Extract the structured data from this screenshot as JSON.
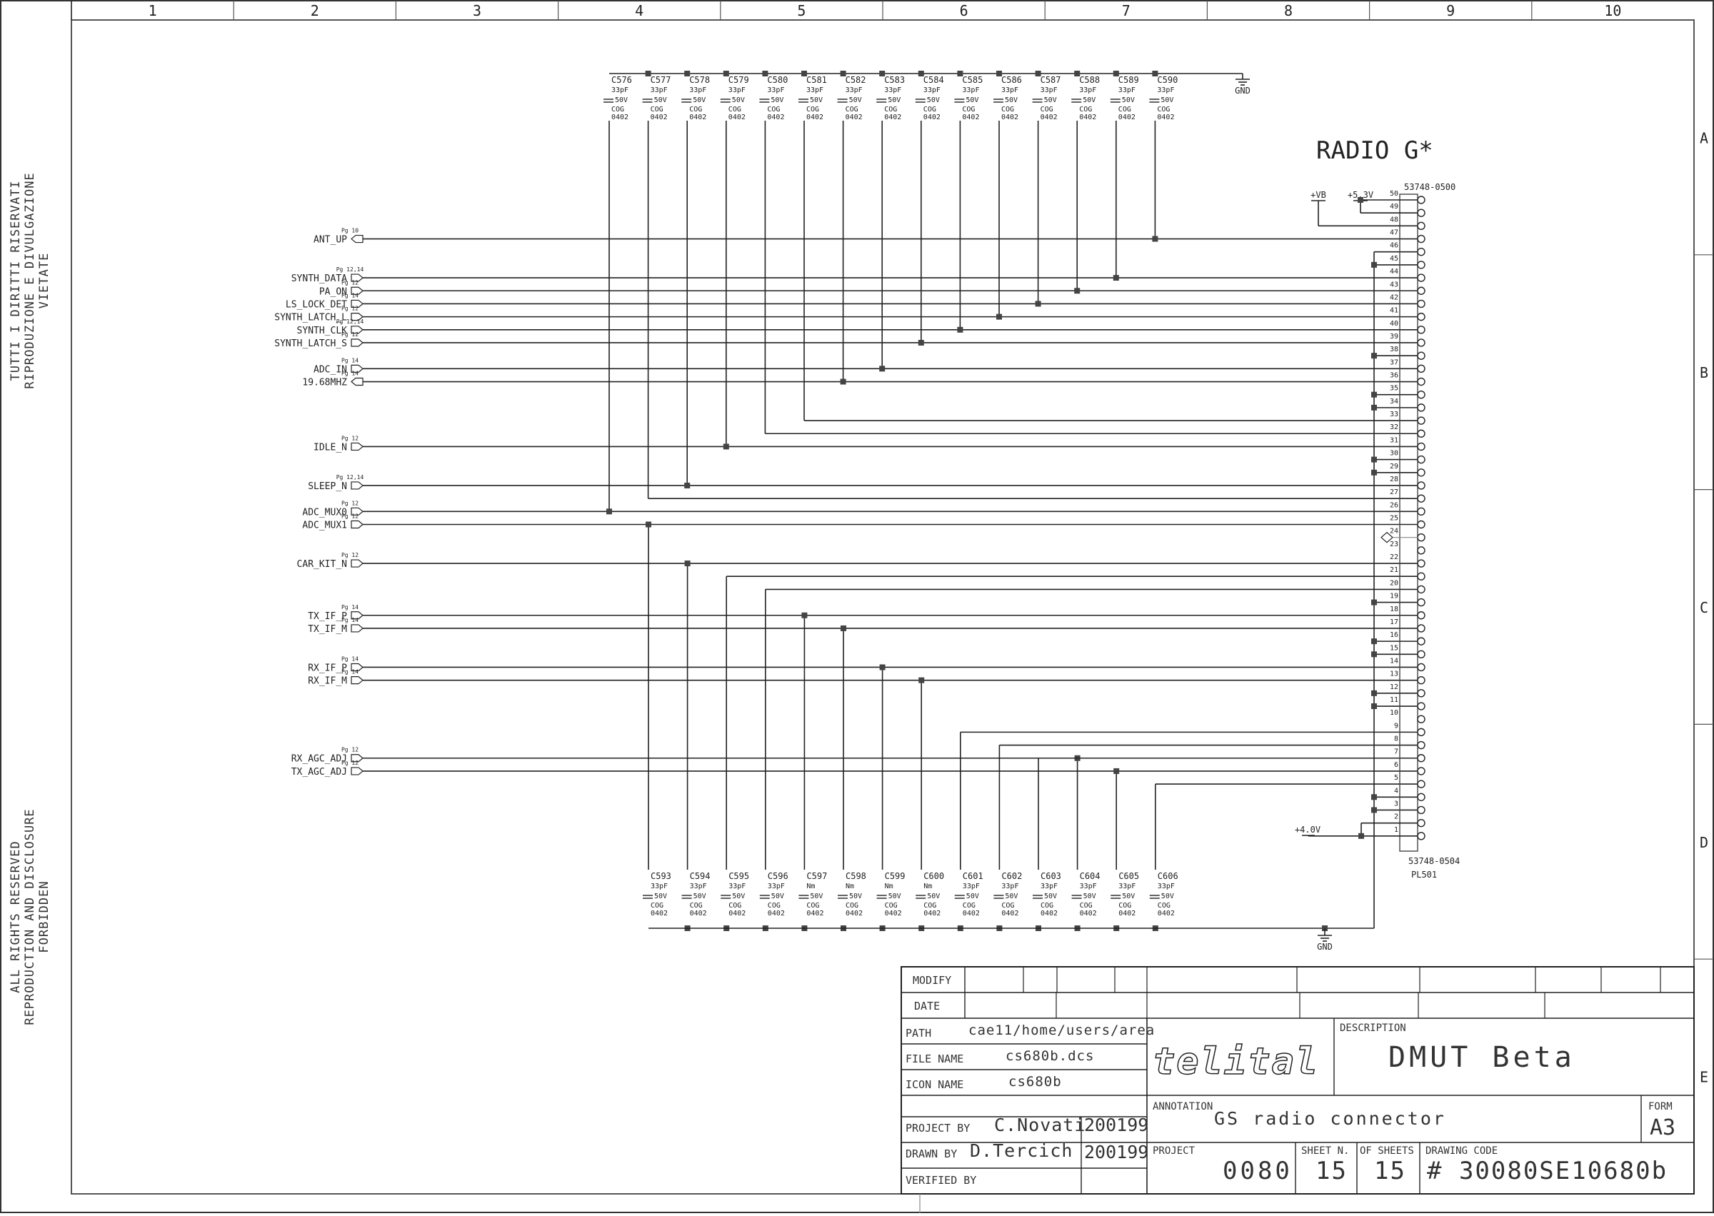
{
  "border": {
    "columns": [
      "1",
      "2",
      "3",
      "4",
      "5",
      "6",
      "7",
      "8",
      "9",
      "10"
    ],
    "rows": [
      "A",
      "B",
      "C",
      "D",
      "E"
    ]
  },
  "side_notes": {
    "italian": [
      "TUTTI I DIRITTI RISERVATI",
      "RIPRODUZIONE E DIVULGAZIONE",
      "VIETATE"
    ],
    "english": [
      "ALL RIGHTS RESERVED",
      "REPRODUCTION AND DISCLOSURE",
      "FORBIDDEN"
    ]
  },
  "schematic": {
    "title": "RADIO G*",
    "gnd_label": "GND",
    "connector": {
      "part_top": "53748-0500",
      "part_bottom": "53748-0504",
      "ref": "PL501",
      "pins": [
        50,
        49,
        48,
        47,
        46,
        45,
        44,
        43,
        42,
        41,
        40,
        39,
        38,
        37,
        36,
        35,
        34,
        33,
        32,
        31,
        30,
        29,
        28,
        27,
        26,
        25,
        24,
        23,
        22,
        21,
        20,
        19,
        18,
        17,
        16,
        15,
        14,
        13,
        12,
        11,
        10,
        9,
        8,
        7,
        6,
        5,
        4,
        3,
        2,
        1
      ]
    },
    "power_rails": [
      {
        "label": "+VB",
        "pin": 48
      },
      {
        "label": "+5.3V",
        "pins": [
          50,
          49
        ]
      },
      {
        "label": "+4.0V",
        "pins": [
          2,
          1
        ]
      }
    ],
    "caps_top": [
      {
        "ref": "C576",
        "value": "33pF",
        "voltage": "50V",
        "dielectric": "COG",
        "package": "0402"
      },
      {
        "ref": "C577",
        "value": "33pF",
        "voltage": "50V",
        "dielectric": "COG",
        "package": "0402"
      },
      {
        "ref": "C578",
        "value": "33pF",
        "voltage": "50V",
        "dielectric": "COG",
        "package": "0402"
      },
      {
        "ref": "C579",
        "value": "33pF",
        "voltage": "50V",
        "dielectric": "COG",
        "package": "0402"
      },
      {
        "ref": "C580",
        "value": "33pF",
        "voltage": "50V",
        "dielectric": "COG",
        "package": "0402"
      },
      {
        "ref": "C581",
        "value": "33pF",
        "voltage": "50V",
        "dielectric": "COG",
        "package": "0402"
      },
      {
        "ref": "C582",
        "value": "33pF",
        "voltage": "50V",
        "dielectric": "COG",
        "package": "0402"
      },
      {
        "ref": "C583",
        "value": "33pF",
        "voltage": "50V",
        "dielectric": "COG",
        "package": "0402"
      },
      {
        "ref": "C584",
        "value": "33pF",
        "voltage": "50V",
        "dielectric": "COG",
        "package": "0402"
      },
      {
        "ref": "C585",
        "value": "33pF",
        "voltage": "50V",
        "dielectric": "COG",
        "package": "0402"
      },
      {
        "ref": "C586",
        "value": "33pF",
        "voltage": "50V",
        "dielectric": "COG",
        "package": "0402"
      },
      {
        "ref": "C587",
        "value": "33pF",
        "voltage": "50V",
        "dielectric": "COG",
        "package": "0402"
      },
      {
        "ref": "C588",
        "value": "33pF",
        "voltage": "50V",
        "dielectric": "COG",
        "package": "0402"
      },
      {
        "ref": "C589",
        "value": "33pF",
        "voltage": "50V",
        "dielectric": "COG",
        "package": "0402"
      },
      {
        "ref": "C590",
        "value": "33pF",
        "voltage": "50V",
        "dielectric": "COG",
        "package": "0402"
      }
    ],
    "caps_bottom": [
      {
        "ref": "C593",
        "value": "33pF",
        "voltage": "50V",
        "dielectric": "COG",
        "package": "0402"
      },
      {
        "ref": "C594",
        "value": "33pF",
        "voltage": "50V",
        "dielectric": "COG",
        "package": "0402"
      },
      {
        "ref": "C595",
        "value": "33pF",
        "voltage": "50V",
        "dielectric": "COG",
        "package": "0402"
      },
      {
        "ref": "C596",
        "value": "33pF",
        "voltage": "50V",
        "dielectric": "COG",
        "package": "0402"
      },
      {
        "ref": "C597",
        "value": "Nm",
        "voltage": "50V",
        "dielectric": "COG",
        "package": "0402"
      },
      {
        "ref": "C598",
        "value": "Nm",
        "voltage": "50V",
        "dielectric": "COG",
        "package": "0402"
      },
      {
        "ref": "C599",
        "value": "Nm",
        "voltage": "50V",
        "dielectric": "COG",
        "package": "0402"
      },
      {
        "ref": "C600",
        "value": "Nm",
        "voltage": "50V",
        "dielectric": "COG",
        "package": "0402"
      },
      {
        "ref": "C601",
        "value": "33pF",
        "voltage": "50V",
        "dielectric": "COG",
        "package": "0402"
      },
      {
        "ref": "C602",
        "value": "33pF",
        "voltage": "50V",
        "dielectric": "COG",
        "package": "0402"
      },
      {
        "ref": "C603",
        "value": "33pF",
        "voltage": "50V",
        "dielectric": "COG",
        "package": "0402"
      },
      {
        "ref": "C604",
        "value": "33pF",
        "voltage": "50V",
        "dielectric": "COG",
        "package": "0402"
      },
      {
        "ref": "C605",
        "value": "33pF",
        "voltage": "50V",
        "dielectric": "COG",
        "package": "0402"
      },
      {
        "ref": "C606",
        "value": "33pF",
        "voltage": "50V",
        "dielectric": "COG",
        "package": "0402"
      }
    ],
    "signals": [
      {
        "name": "ANT_UP",
        "page": "Pg 10",
        "pin": 47,
        "dir": "in",
        "cap": "C590"
      },
      {
        "name": "SYNTH_DATA",
        "page": "Pg 12,14",
        "pin": 44,
        "dir": "out",
        "cap": "C589"
      },
      {
        "name": "PA_ON",
        "page": "Pg 12",
        "pin": 43,
        "dir": "out",
        "cap": "C588"
      },
      {
        "name": "LS_LOCK_DET",
        "page": "Pg 14",
        "pin": 42,
        "dir": "out",
        "cap": "C587"
      },
      {
        "name": "SYNTH_LATCH_L",
        "page": "Pg 12",
        "pin": 41,
        "dir": "out",
        "cap": "C586"
      },
      {
        "name": "SYNTH_CLK",
        "page": "Pg 12,14",
        "pin": 40,
        "dir": "out",
        "cap": "C585"
      },
      {
        "name": "SYNTH_LATCH_S",
        "page": "Pg 12",
        "pin": 39,
        "dir": "out",
        "cap": "C584"
      },
      {
        "name": "ADC_IN",
        "page": "Pg 14",
        "pin": 37,
        "dir": "out",
        "cap": "C583"
      },
      {
        "name": "19.68MHZ",
        "page": "Pg 14",
        "pin": 36,
        "dir": "in",
        "cap": "C582"
      },
      {
        "name": "IDLE_N",
        "page": "Pg 12",
        "pin": 31,
        "dir": "out",
        "cap": "C579"
      },
      {
        "name": "SLEEP_N",
        "page": "Pg 12,14",
        "pin": 28,
        "dir": "out",
        "cap": "C578"
      },
      {
        "name": "ADC_MUX0",
        "page": "Pg 12",
        "pin": 26,
        "dir": "out",
        "cap": "C576"
      },
      {
        "name": "ADC_MUX1",
        "page": "Pg 12",
        "pin": 25,
        "dir": "out",
        "cap": "C593"
      },
      {
        "name": "CAR_KIT_N",
        "page": "Pg 12",
        "pin": 22,
        "dir": "out",
        "cap": "C594"
      },
      {
        "name": "TX_IF_P",
        "page": "Pg 14",
        "pin": 18,
        "dir": "out",
        "cap": "C597"
      },
      {
        "name": "TX_IF_M",
        "page": "Pg 14",
        "pin": 17,
        "dir": "out",
        "cap": "C598"
      },
      {
        "name": "RX_IF_P",
        "page": "Pg 14",
        "pin": 14,
        "dir": "out",
        "cap": "C599"
      },
      {
        "name": "RX_IF_M",
        "page": "Pg 14",
        "pin": 13,
        "dir": "out",
        "cap": "C600"
      },
      {
        "name": "RX_AGC_ADJ",
        "page": "Pg 12",
        "pin": 7,
        "dir": "out",
        "cap": "C604"
      },
      {
        "name": "TX_AGC_ADJ",
        "page": "Pg 12",
        "pin": 6,
        "dir": "out",
        "cap": "C605"
      }
    ],
    "cap_only_nets": [
      {
        "cap": "C581",
        "pin": 33
      },
      {
        "cap": "C580",
        "pin": 32
      },
      {
        "cap": "C577",
        "pin": 27
      },
      {
        "cap": "C596",
        "pin": 20
      },
      {
        "cap": "C595",
        "pin": 21
      },
      {
        "cap": "C601",
        "pin": 9
      },
      {
        "cap": "C602",
        "pin": 8
      },
      {
        "cap": "C603",
        "pin": 7
      },
      {
        "cap": "C606",
        "pin": 5
      }
    ],
    "gnd_pins": [
      45,
      38,
      35,
      34,
      30,
      29,
      19,
      16,
      15,
      12,
      11,
      4,
      3
    ],
    "nc_pin": 24
  },
  "title_block": {
    "modify_label": "MODIFY",
    "date_label": "DATE",
    "path_label": "PATH",
    "path_value": "cae11/home/users/area",
    "file_name_label": "FILE NAME",
    "file_name_value": "cs680b.dcs",
    "icon_name_label": "ICON NAME",
    "icon_name_value": "cs680b",
    "project_by_label": "PROJECT BY",
    "project_by_value": "C.Novati",
    "project_by_date": "200199",
    "drawn_by_label": "DRAWN BY",
    "drawn_by_value": "D.Tercich",
    "drawn_by_date": "200199",
    "verified_by_label": "VERIFIED BY",
    "company": "telital",
    "description_label": "DESCRIPTION",
    "description_value": "DMUT Beta",
    "annotation_label": "ANNOTATION",
    "annotation_value": "GS radio connector",
    "form_label": "FORM",
    "form_value": "A3",
    "project_label": "PROJECT",
    "project_value": "0080",
    "sheet_n_label": "SHEET N.",
    "sheet_n_value": "15",
    "of_sheets_label": "OF SHEETS",
    "of_sheets_value": "15",
    "drawing_code_label": "DRAWING CODE",
    "drawing_code_value": "# 30080SE10680b"
  }
}
